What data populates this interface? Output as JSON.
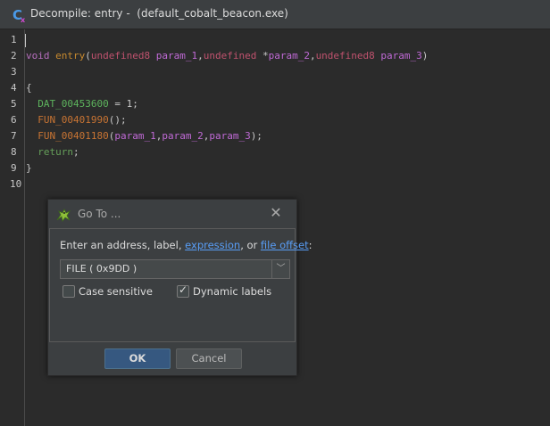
{
  "window": {
    "title": "Decompile: entry -  (default_cobalt_beacon.exe)",
    "icon": "decompiler-icon"
  },
  "editor": {
    "line_numbers": [
      "1",
      "2",
      "3",
      "4",
      "5",
      "6",
      "7",
      "8",
      "9",
      "10"
    ],
    "lines": [
      {
        "parts": []
      },
      {
        "parts": [
          {
            "t": "void",
            "c": "kw"
          },
          {
            "t": " ",
            "c": "pn"
          },
          {
            "t": "entry",
            "c": "fn"
          },
          {
            "t": "(",
            "c": "pn"
          },
          {
            "t": "undefined8",
            "c": "ty"
          },
          {
            "t": " ",
            "c": "pn"
          },
          {
            "t": "param_1",
            "c": "pa"
          },
          {
            "t": ",",
            "c": "pn"
          },
          {
            "t": "undefined",
            "c": "ty"
          },
          {
            "t": " *",
            "c": "pn"
          },
          {
            "t": "param_2",
            "c": "pa"
          },
          {
            "t": ",",
            "c": "pn"
          },
          {
            "t": "undefined8",
            "c": "ty"
          },
          {
            "t": " ",
            "c": "pn"
          },
          {
            "t": "param_3",
            "c": "pa"
          },
          {
            "t": ")",
            "c": "pn"
          }
        ]
      },
      {
        "parts": []
      },
      {
        "parts": [
          {
            "t": "{",
            "c": "pn"
          }
        ]
      },
      {
        "parts": [
          {
            "t": "  ",
            "c": "pn"
          },
          {
            "t": "DAT_00453600",
            "c": "dat"
          },
          {
            "t": " = 1;",
            "c": "pn"
          }
        ]
      },
      {
        "parts": [
          {
            "t": "  ",
            "c": "pn"
          },
          {
            "t": "FUN_00401990",
            "c": "fun"
          },
          {
            "t": "();",
            "c": "pn"
          }
        ]
      },
      {
        "parts": [
          {
            "t": "  ",
            "c": "pn"
          },
          {
            "t": "FUN_00401180",
            "c": "fun"
          },
          {
            "t": "(",
            "c": "pn"
          },
          {
            "t": "param_1",
            "c": "pa"
          },
          {
            "t": ",",
            "c": "pn"
          },
          {
            "t": "param_2",
            "c": "pa"
          },
          {
            "t": ",",
            "c": "pn"
          },
          {
            "t": "param_3",
            "c": "pa"
          },
          {
            "t": ");",
            "c": "pn"
          }
        ]
      },
      {
        "parts": [
          {
            "t": "  ",
            "c": "pn"
          },
          {
            "t": "return",
            "c": "ret"
          },
          {
            "t": ";",
            "c": "pn"
          }
        ]
      },
      {
        "parts": [
          {
            "t": "}",
            "c": "pn"
          }
        ]
      },
      {
        "parts": []
      }
    ]
  },
  "dialog": {
    "title": "Go To ...",
    "icon": "dragon-icon",
    "prompt_prefix": "Enter an address, label, ",
    "link_expression": "expression",
    "prompt_mid": ", or ",
    "link_file_offset": "file offset",
    "prompt_suffix": ":",
    "combo_value": "FILE ( 0x9DD )",
    "case_sensitive_label": "Case sensitive",
    "case_sensitive_checked": false,
    "dynamic_labels_label": "Dynamic labels",
    "dynamic_labels_checked": true,
    "ok_label": "OK",
    "cancel_label": "Cancel"
  }
}
